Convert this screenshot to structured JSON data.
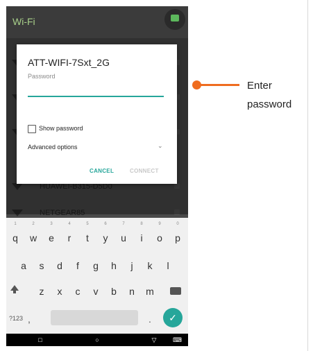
{
  "app": {
    "title": "Wi-Fi"
  },
  "networks": [
    {
      "name": "HUAWEI-B315-D5D0"
    },
    {
      "name": "NETGEAR85"
    }
  ],
  "dialog": {
    "network_name": "ATT-WIFI-7Sxt_2G",
    "password_label": "Password",
    "password_value": "",
    "show_password_label": "Show password",
    "advanced_label": "Advanced options",
    "cancel_label": "CANCEL",
    "connect_label": "CONNECT"
  },
  "keyboard": {
    "row1": [
      "q",
      "w",
      "e",
      "r",
      "t",
      "y",
      "u",
      "i",
      "o",
      "p"
    ],
    "row1_numbers": [
      "1",
      "2",
      "3",
      "4",
      "5",
      "6",
      "7",
      "8",
      "9",
      "0"
    ],
    "row2": [
      "a",
      "s",
      "d",
      "f",
      "g",
      "h",
      "j",
      "k",
      "l"
    ],
    "row3": [
      "z",
      "x",
      "c",
      "v",
      "b",
      "n",
      "m"
    ],
    "symbols_label": "?123",
    "comma": ",",
    "period": "."
  },
  "annotation": {
    "line1": "Enter",
    "line2": "password",
    "color": "#ef6c1f"
  },
  "colors": {
    "accent": "#26a69a",
    "appbar_title": "#a8d08a"
  }
}
